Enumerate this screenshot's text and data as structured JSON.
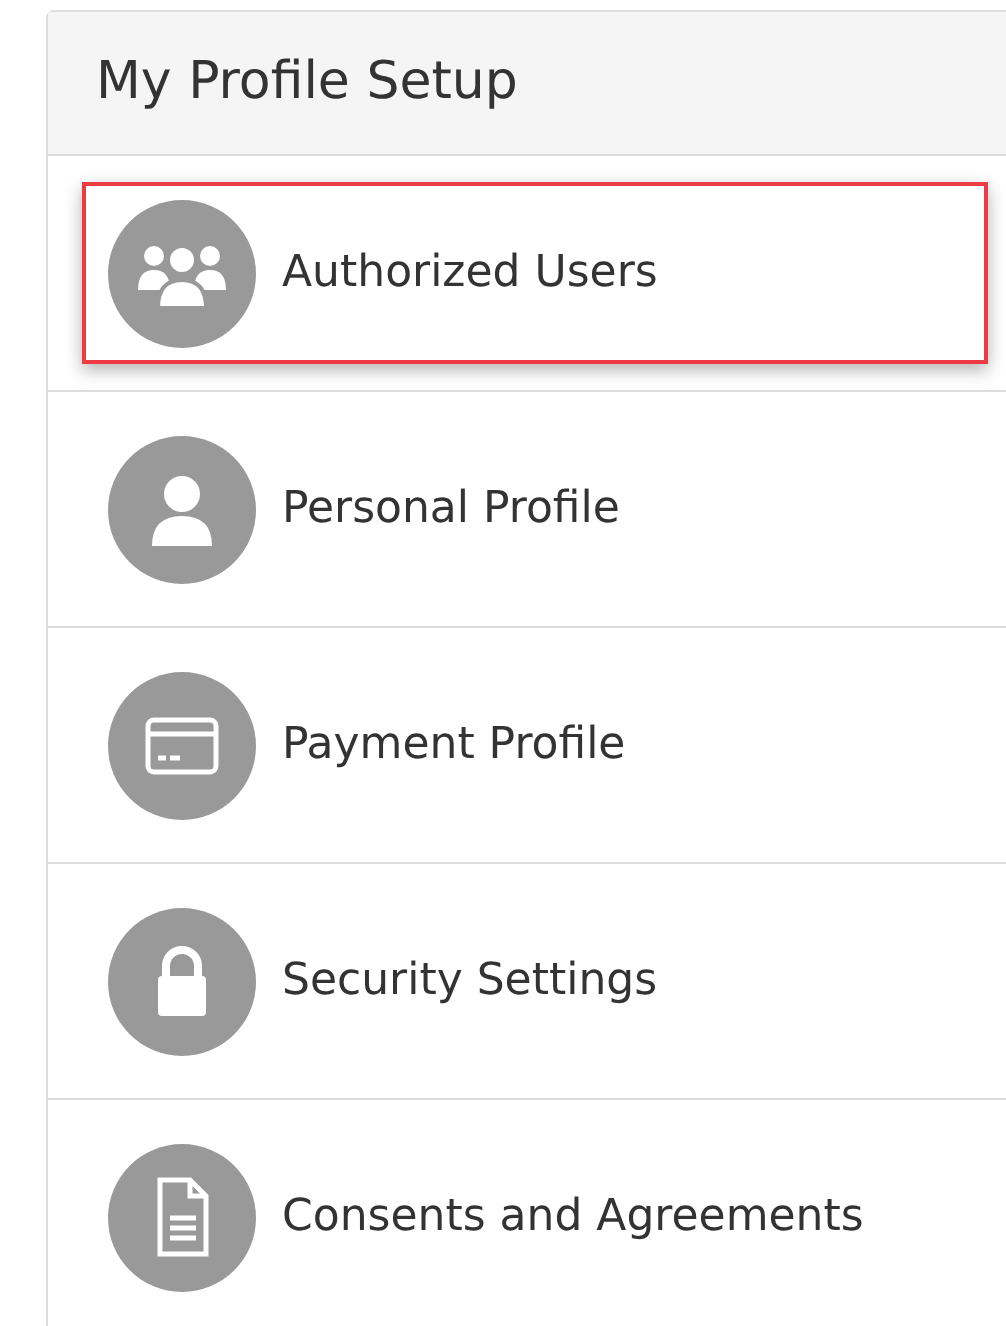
{
  "panel": {
    "title": "My Profile Setup"
  },
  "items": [
    {
      "label": "Authorized Users",
      "kind": "users",
      "highlighted": true
    },
    {
      "label": "Personal Profile",
      "kind": "person",
      "highlighted": false
    },
    {
      "label": "Payment Profile",
      "kind": "card",
      "highlighted": false
    },
    {
      "label": "Security Settings",
      "kind": "lock",
      "highlighted": false
    },
    {
      "label": "Consents and Agreements",
      "kind": "document",
      "highlighted": false
    }
  ]
}
